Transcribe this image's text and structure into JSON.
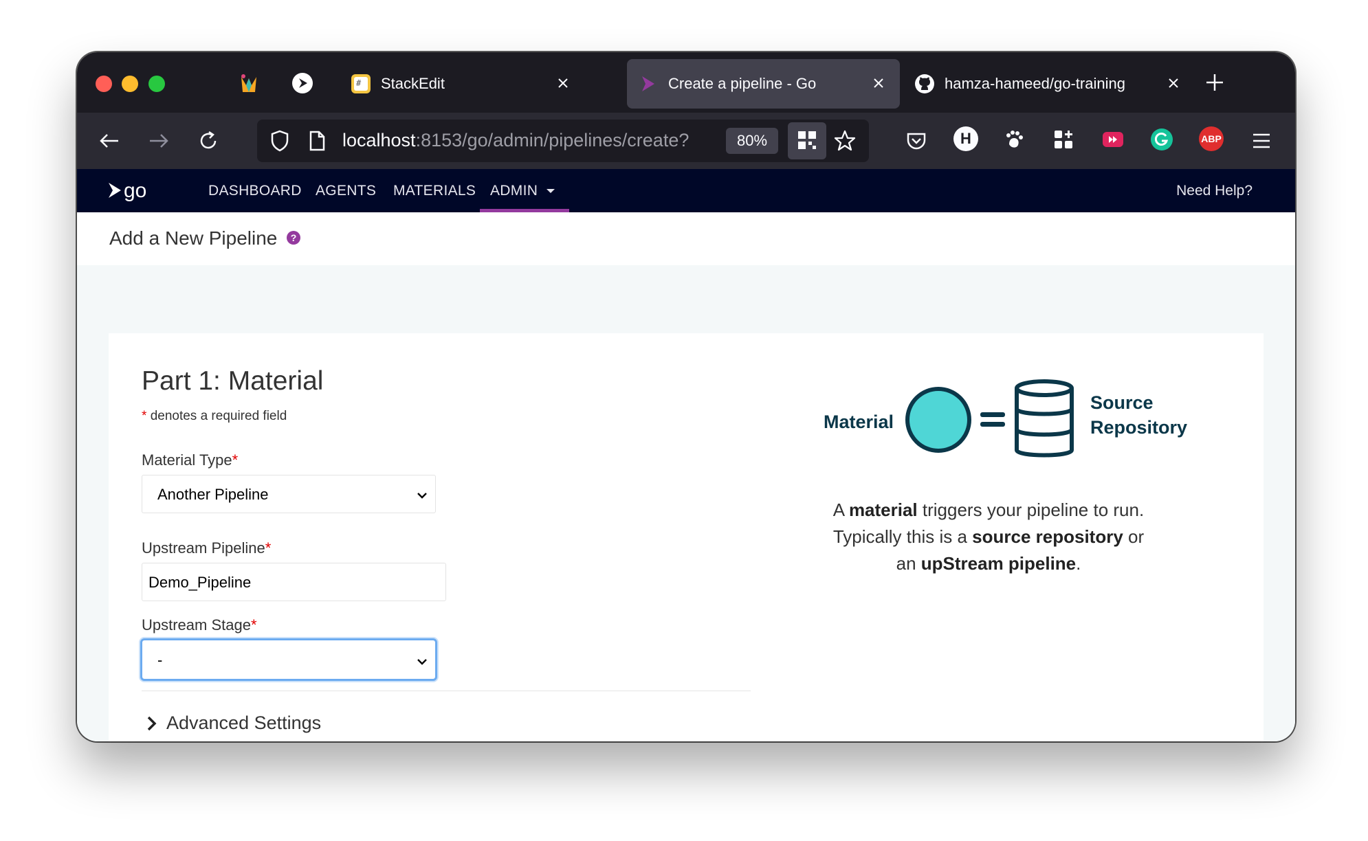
{
  "browser": {
    "tabs": [
      {
        "title": "StackEdit",
        "active": false
      },
      {
        "title": "Create a pipeline - Go",
        "active": true
      },
      {
        "title": "hamza-hameed/go-training",
        "active": false
      }
    ],
    "url_host": "localhost",
    "url_rest": ":8153/go/admin/pipelines/create?",
    "zoom": "80%",
    "extensions": {
      "h_label": "H",
      "abp_label": "ABP"
    }
  },
  "header": {
    "logo_text": "go",
    "nav": [
      "DASHBOARD",
      "AGENTS",
      "MATERIALS",
      "ADMIN"
    ],
    "help_label": "Need Help?"
  },
  "page": {
    "title": "Add a New Pipeline"
  },
  "form": {
    "part_title": "Part 1: Material",
    "required_note": "denotes a required field",
    "asterisk": "*",
    "material_type_label": "Material Type",
    "material_type_value": "Another Pipeline",
    "upstream_pipeline_label": "Upstream Pipeline",
    "upstream_pipeline_value": "Demo_Pipeline",
    "upstream_stage_label": "Upstream Stage",
    "upstream_stage_value": "-",
    "advanced_label": "Advanced Settings"
  },
  "info": {
    "material_label": "Material",
    "source_line1": "Source",
    "source_line2": "Repository",
    "desc": {
      "p1": "A ",
      "b1": "material",
      "p2": " triggers your pipeline to run.",
      "p3": "Typically this is a ",
      "b2": "source repository",
      "p4": " or",
      "p5": "an ",
      "b3": "upStream pipeline",
      "p6": "."
    }
  },
  "colors": {
    "go_header": "#000728",
    "accent_purple": "#943a9e",
    "required_red": "#e10000",
    "focus_blue": "#6cabf0",
    "material_teal": "#4fd6d6",
    "diagram_navy": "#0b3749"
  }
}
